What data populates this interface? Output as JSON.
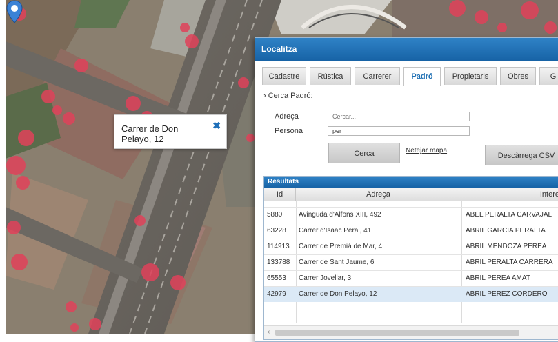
{
  "map": {
    "popup": {
      "text": "Carrer de Don Pelayo, 12",
      "close_icon": "close-icon"
    },
    "pin_icon": "map-pin-icon"
  },
  "dialog": {
    "title": "Localitza",
    "tabs": [
      {
        "label": "Cadastre"
      },
      {
        "label": "Rústica"
      },
      {
        "label": "Carrerer"
      },
      {
        "label": "Padró",
        "active": true
      },
      {
        "label": "Propietaris"
      },
      {
        "label": "Obres"
      },
      {
        "label": "G"
      }
    ],
    "section_title": "› Cerca Padró:",
    "form": {
      "address_label": "Adreça",
      "address_placeholder": "Cercar...",
      "person_label": "Persona",
      "person_value": "per",
      "search_button": "Cerca",
      "clear_map_link": "Netejar mapa",
      "download_csv_button": "Descàrrega CSV"
    },
    "results": {
      "title": "Resultats",
      "columns": [
        "Id",
        "Adreça",
        "Interess"
      ],
      "rows": [
        {
          "id": "5880",
          "address": "Avinguda d'Alfons XIII, 492",
          "interested": "ABEL PERALTA CARVAJAL"
        },
        {
          "id": "63228",
          "address": "Carrer d'Isaac Peral, 41",
          "interested": "ABRIL GARCIA PERALTA"
        },
        {
          "id": "114913",
          "address": "Carrer de Premià de Mar, 4",
          "interested": "ABRIL MENDOZA PEREA"
        },
        {
          "id": "133788",
          "address": "Carrer de Sant Jaume, 6",
          "interested": "ABRIL PERALTA CARRERA"
        },
        {
          "id": "65553",
          "address": "Carrer Jovellar, 3",
          "interested": "ABRIL PEREA AMAT"
        },
        {
          "id": "42979",
          "address": "Carrer de Don Pelayo, 12",
          "interested": "ABRIL PEREZ CORDERO",
          "selected": true
        }
      ]
    }
  },
  "colors": {
    "accent": "#1e6fb3",
    "selected_row": "#dbe9f6",
    "map_dot": "#e0425a"
  }
}
